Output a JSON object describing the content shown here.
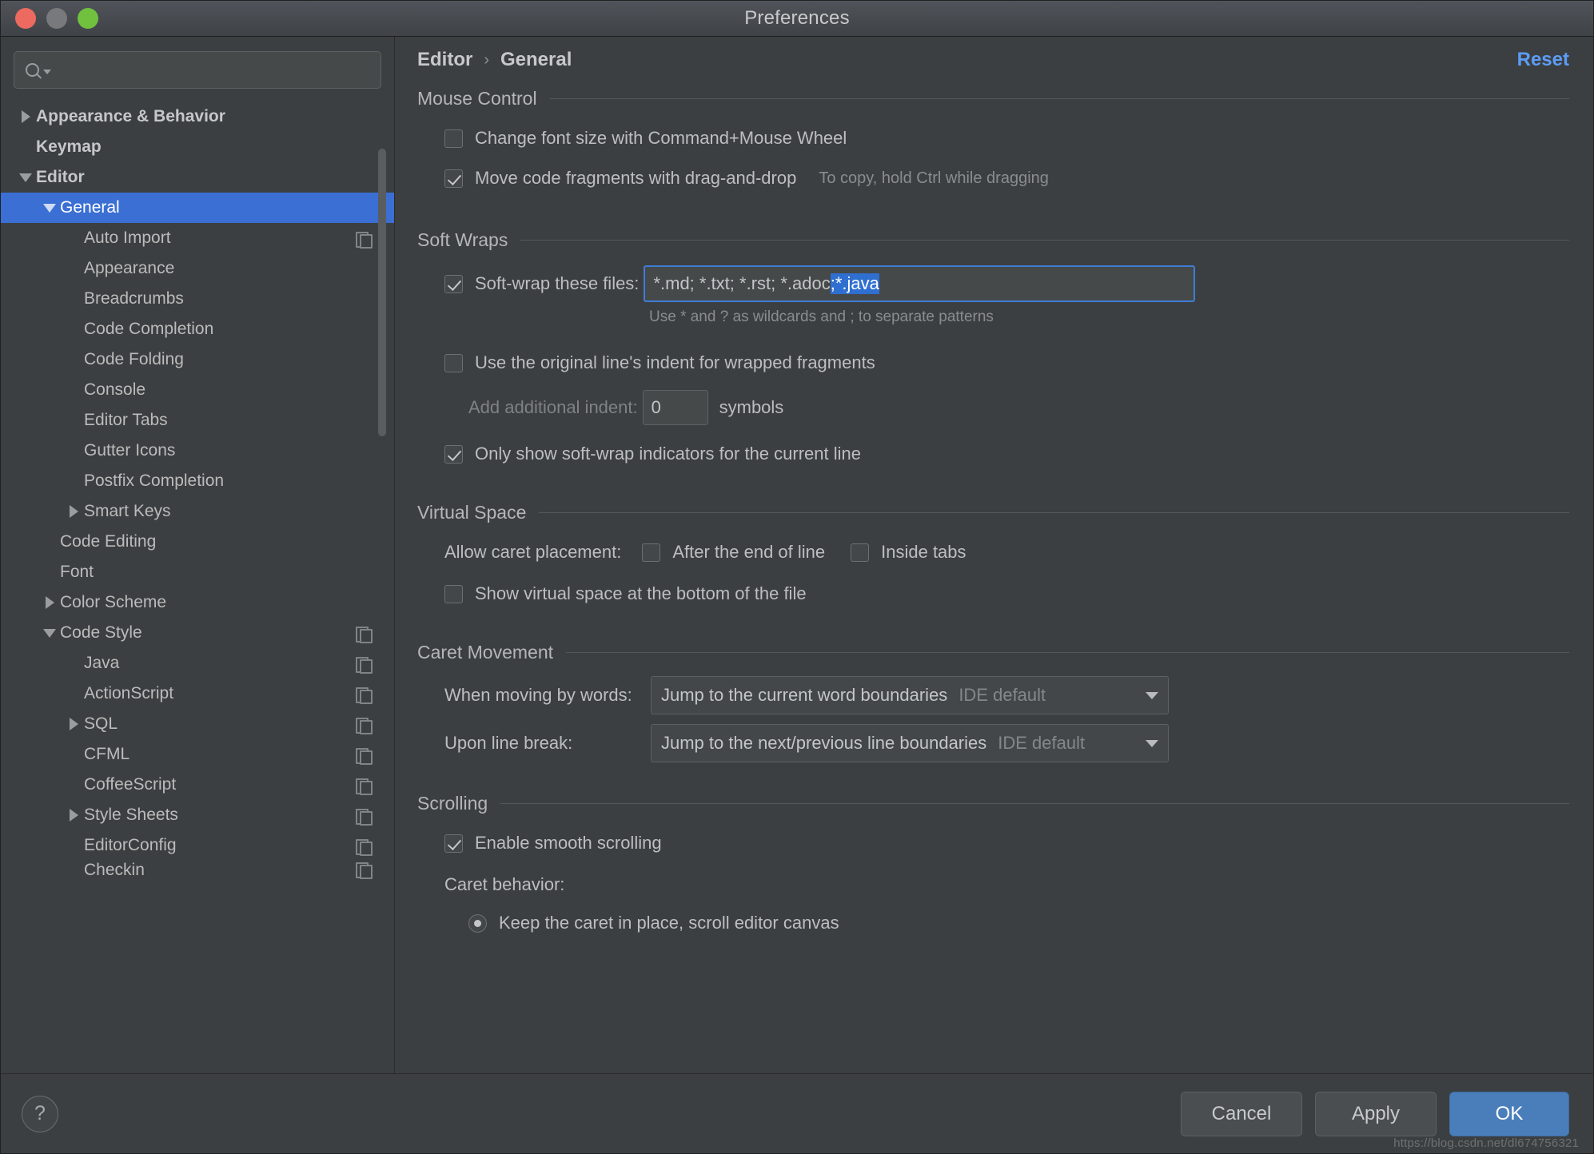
{
  "window": {
    "title": "Preferences",
    "traffic_lights": [
      "close-button",
      "minimize-button",
      "zoom-button"
    ]
  },
  "search": {
    "value": "",
    "placeholder": ""
  },
  "sidebar": {
    "items": [
      {
        "label": "Appearance & Behavior",
        "level": 0,
        "twisty": "right",
        "bold": true,
        "selected": false,
        "copy": false
      },
      {
        "label": "Keymap",
        "level": 0,
        "twisty": "none",
        "bold": true,
        "selected": false,
        "copy": false
      },
      {
        "label": "Editor",
        "level": 0,
        "twisty": "down",
        "bold": true,
        "selected": false,
        "copy": false
      },
      {
        "label": "General",
        "level": 1,
        "twisty": "down",
        "bold": false,
        "selected": true,
        "copy": false
      },
      {
        "label": "Auto Import",
        "level": 2,
        "twisty": "none",
        "bold": false,
        "selected": false,
        "copy": true
      },
      {
        "label": "Appearance",
        "level": 2,
        "twisty": "none",
        "bold": false,
        "selected": false,
        "copy": false
      },
      {
        "label": "Breadcrumbs",
        "level": 2,
        "twisty": "none",
        "bold": false,
        "selected": false,
        "copy": false
      },
      {
        "label": "Code Completion",
        "level": 2,
        "twisty": "none",
        "bold": false,
        "selected": false,
        "copy": false
      },
      {
        "label": "Code Folding",
        "level": 2,
        "twisty": "none",
        "bold": false,
        "selected": false,
        "copy": false
      },
      {
        "label": "Console",
        "level": 2,
        "twisty": "none",
        "bold": false,
        "selected": false,
        "copy": false
      },
      {
        "label": "Editor Tabs",
        "level": 2,
        "twisty": "none",
        "bold": false,
        "selected": false,
        "copy": false
      },
      {
        "label": "Gutter Icons",
        "level": 2,
        "twisty": "none",
        "bold": false,
        "selected": false,
        "copy": false
      },
      {
        "label": "Postfix Completion",
        "level": 2,
        "twisty": "none",
        "bold": false,
        "selected": false,
        "copy": false
      },
      {
        "label": "Smart Keys",
        "level": 2,
        "twisty": "right",
        "bold": false,
        "selected": false,
        "copy": false
      },
      {
        "label": "Code Editing",
        "level": 1,
        "twisty": "none",
        "bold": false,
        "selected": false,
        "copy": false
      },
      {
        "label": "Font",
        "level": 1,
        "twisty": "none",
        "bold": false,
        "selected": false,
        "copy": false
      },
      {
        "label": "Color Scheme",
        "level": 1,
        "twisty": "right",
        "bold": false,
        "selected": false,
        "copy": false
      },
      {
        "label": "Code Style",
        "level": 1,
        "twisty": "down",
        "bold": false,
        "selected": false,
        "copy": true
      },
      {
        "label": "Java",
        "level": 2,
        "twisty": "none",
        "bold": false,
        "selected": false,
        "copy": true
      },
      {
        "label": "ActionScript",
        "level": 2,
        "twisty": "none",
        "bold": false,
        "selected": false,
        "copy": true
      },
      {
        "label": "SQL",
        "level": 2,
        "twisty": "right",
        "bold": false,
        "selected": false,
        "copy": true
      },
      {
        "label": "CFML",
        "level": 2,
        "twisty": "none",
        "bold": false,
        "selected": false,
        "copy": true
      },
      {
        "label": "CoffeeScript",
        "level": 2,
        "twisty": "none",
        "bold": false,
        "selected": false,
        "copy": true
      },
      {
        "label": "Style Sheets",
        "level": 2,
        "twisty": "right",
        "bold": false,
        "selected": false,
        "copy": true
      },
      {
        "label": "EditorConfig",
        "level": 2,
        "twisty": "none",
        "bold": false,
        "selected": false,
        "copy": true
      },
      {
        "label": "Checkin",
        "level": 2,
        "twisty": "none",
        "bold": false,
        "selected": false,
        "copy": true
      }
    ]
  },
  "breadcrumb": {
    "root": "Editor",
    "separator": "›",
    "leaf": "General"
  },
  "reset": {
    "label": "Reset"
  },
  "sections": {
    "mouse_control": {
      "title": "Mouse Control",
      "change_font_size": {
        "label": "Change font size with Command+Mouse Wheel",
        "checked": false
      },
      "move_code_fragments": {
        "label": "Move code fragments with drag-and-drop",
        "checked": true,
        "hint": "To copy, hold Ctrl while dragging"
      }
    },
    "soft_wraps": {
      "title": "Soft Wraps",
      "soft_wrap_files": {
        "label": "Soft-wrap these files:",
        "checked": true,
        "value_plain": "*.md; *.txt; *.rst; *.adoc",
        "value_selected": ";*.java",
        "full_value": "*.md; *.txt; *.rst; *.adoc;*.java"
      },
      "hint": "Use * and ? as wildcards and ; to separate patterns",
      "use_original_indent": {
        "label": "Use the original line's indent for wrapped fragments",
        "checked": false
      },
      "additional_indent": {
        "label": "Add additional indent:",
        "value": "0",
        "suffix": "symbols"
      },
      "only_show_indicators": {
        "label": "Only show soft-wrap indicators for the current line",
        "checked": true
      }
    },
    "virtual_space": {
      "title": "Virtual Space",
      "allow_caret_placement_label": "Allow caret placement:",
      "after_end_of_line": {
        "label": "After the end of line",
        "checked": false
      },
      "inside_tabs": {
        "label": "Inside tabs",
        "checked": false
      },
      "show_virtual_space": {
        "label": "Show virtual space at the bottom of the file",
        "checked": false
      }
    },
    "caret_movement": {
      "title": "Caret Movement",
      "when_moving_by_words": {
        "label": "When moving by words:",
        "value": "Jump to the current word boundaries",
        "suffix": "IDE default"
      },
      "upon_line_break": {
        "label": "Upon line break:",
        "value": "Jump to the next/previous line boundaries",
        "suffix": "IDE default"
      }
    },
    "scrolling": {
      "title": "Scrolling",
      "enable_smooth_scrolling": {
        "label": "Enable smooth scrolling",
        "checked": true
      },
      "caret_behavior_label": "Caret behavior:",
      "keep_caret_in_place": {
        "label": "Keep the caret in place, scroll editor canvas",
        "selected": true
      }
    }
  },
  "footer": {
    "help_label": "?",
    "cancel_label": "Cancel",
    "apply_label": "Apply",
    "ok_label": "OK"
  },
  "watermark": "https://blog.csdn.net/dl674756321",
  "colors": {
    "accent_selection": "#3b6fd4",
    "link": "#5c9cf5",
    "primary_button": "#4a7ebb",
    "text_selection": "#2f6fd0"
  }
}
